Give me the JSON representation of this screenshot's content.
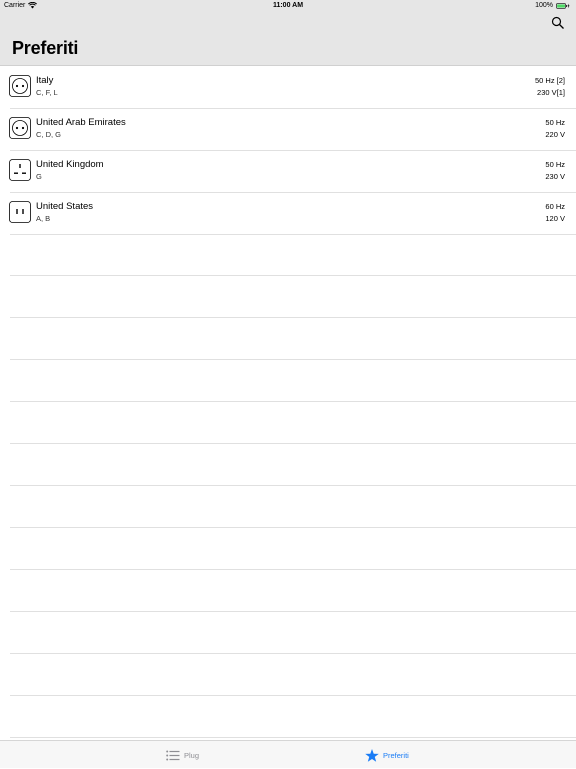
{
  "status_bar": {
    "carrier": "Carrier",
    "time": "11:00 AM",
    "battery": "100%",
    "icons": [
      "wifi-icon",
      "battery-icon",
      "charging-icon"
    ]
  },
  "nav": {
    "title": "Preferiti",
    "search_icon": "search-icon"
  },
  "favorites": [
    {
      "country": "Italy",
      "types": "C, F, L",
      "frequency": "50 Hz [2]",
      "voltage": "230 V[1]",
      "icon": "socket-round-icon"
    },
    {
      "country": "United Arab Emirates",
      "types": "C, D, G",
      "frequency": "50 Hz",
      "voltage": "220 V",
      "icon": "socket-round-icon"
    },
    {
      "country": "United Kingdom",
      "types": "G",
      "frequency": "50 Hz",
      "voltage": "230 V",
      "icon": "socket-uk-icon"
    },
    {
      "country": "United States",
      "types": "A, B",
      "frequency": "60 Hz",
      "voltage": "120 V",
      "icon": "socket-us-icon"
    }
  ],
  "tab_bar": {
    "tabs": [
      {
        "label": "Plug",
        "icon": "list-icon",
        "selected": false
      },
      {
        "label": "Preferiti",
        "icon": "star-icon",
        "selected": true
      }
    ],
    "accent_color": "#1a7cf5"
  }
}
